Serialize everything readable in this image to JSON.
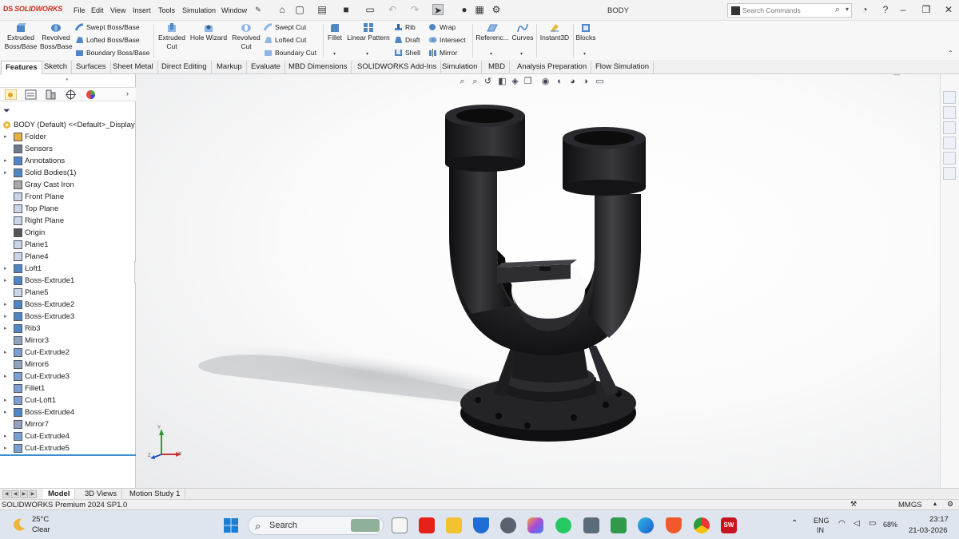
{
  "app": {
    "logo": "SOLIDWORKS",
    "logo_prefix": "DS",
    "document_title": "BODY"
  },
  "menu": [
    "File",
    "Edit",
    "View",
    "Insert",
    "Tools",
    "Simulation",
    "Window"
  ],
  "search": {
    "placeholder": "Search Commands"
  },
  "ribbon": {
    "extruded_boss": "Extruded Boss/Base",
    "revolved_boss": "Revolved Boss/Base",
    "swept_boss": "Swept Boss/Base",
    "lofted_boss": "Lofted Boss/Base",
    "boundary_boss": "Boundary Boss/Base",
    "extruded_cut": "Extruded Cut",
    "hole_wizard": "Hole Wizard",
    "revolved_cut": "Revolved Cut",
    "swept_cut": "Swept Cut",
    "lofted_cut": "Lofted Cut",
    "boundary_cut": "Boundary Cut",
    "fillet": "Fillet",
    "linear_pattern": "Linear Pattern",
    "rib": "Rib",
    "draft": "Draft",
    "shell": "Shell",
    "wrap": "Wrap",
    "intersect": "Intersect",
    "mirror": "Mirror",
    "reference": "Referenc...",
    "curves": "Curves",
    "instant3d": "Instant3D",
    "blocks": "Blocks"
  },
  "tabs": [
    "Features",
    "Sketch",
    "Surfaces",
    "Sheet Metal",
    "Direct Editing",
    "Markup",
    "Evaluate",
    "MBD Dimensions",
    "SOLIDWORKS Add-Ins",
    "Simulation",
    "MBD",
    "Analysis Preparation",
    "Flow Simulation"
  ],
  "tree": {
    "root": "BODY (Default) <<Default>_Display",
    "items": [
      {
        "label": "Folder",
        "expand": true,
        "icon": "folder-icon"
      },
      {
        "label": "Sensors",
        "expand": false,
        "icon": "sensors-icon"
      },
      {
        "label": "Annotations",
        "expand": true,
        "icon": "annotations-icon"
      },
      {
        "label": "Solid Bodies(1)",
        "expand": true,
        "icon": "solid-bodies-icon"
      },
      {
        "label": "Gray Cast Iron",
        "expand": false,
        "icon": "material-icon"
      },
      {
        "label": "Front Plane",
        "expand": false,
        "icon": "plane-icon"
      },
      {
        "label": "Top Plane",
        "expand": false,
        "icon": "plane-icon"
      },
      {
        "label": "Right Plane",
        "expand": false,
        "icon": "plane-icon"
      },
      {
        "label": "Origin",
        "expand": false,
        "icon": "origin-icon"
      },
      {
        "label": "Plane1",
        "expand": false,
        "icon": "plane-icon"
      },
      {
        "label": "Plane4",
        "expand": false,
        "icon": "plane-icon"
      },
      {
        "label": "Loft1",
        "expand": true,
        "icon": "loft-icon"
      },
      {
        "label": "Boss-Extrude1",
        "expand": true,
        "icon": "extrude-icon"
      },
      {
        "label": "Plane5",
        "expand": false,
        "icon": "plane-icon"
      },
      {
        "label": "Boss-Extrude2",
        "expand": true,
        "icon": "extrude-icon"
      },
      {
        "label": "Boss-Extrude3",
        "expand": true,
        "icon": "extrude-icon"
      },
      {
        "label": "Rib3",
        "expand": true,
        "icon": "rib-icon"
      },
      {
        "label": "Mirror3",
        "expand": false,
        "icon": "mirror-icon"
      },
      {
        "label": "Cut-Extrude2",
        "expand": true,
        "icon": "cut-extrude-icon"
      },
      {
        "label": "Mirror6",
        "expand": false,
        "icon": "mirror-icon"
      },
      {
        "label": "Cut-Extrude3",
        "expand": true,
        "icon": "cut-extrude-icon"
      },
      {
        "label": "Fillet1",
        "expand": false,
        "icon": "fillet-icon"
      },
      {
        "label": "Cut-Loft1",
        "expand": true,
        "icon": "cut-loft-icon"
      },
      {
        "label": "Boss-Extrude4",
        "expand": true,
        "icon": "extrude-icon"
      },
      {
        "label": "Mirror7",
        "expand": false,
        "icon": "mirror-icon"
      },
      {
        "label": "Cut-Extrude4",
        "expand": true,
        "icon": "cut-extrude-icon"
      },
      {
        "label": "Cut-Extrude5",
        "expand": true,
        "icon": "cut-extrude-icon"
      }
    ]
  },
  "triad": {
    "x": "X",
    "y": "Y",
    "z": "Z"
  },
  "bottom_tabs": [
    "Model",
    "3D Views",
    "Motion Study 1"
  ],
  "status": {
    "product": "SOLIDWORKS Premium 2024 SP1.0",
    "units": "MMGS"
  },
  "taskbar": {
    "weather_temp": "25°C",
    "weather_desc": "Clear",
    "search_label": "Search",
    "lang1": "ENG",
    "lang2": "IN",
    "battery": "68%",
    "time": "23:17",
    "date": "21-03-2026",
    "sw_badge": "SW"
  },
  "colors": {
    "brand_red": "#d52b1e",
    "selection_blue": "#3a8fd0",
    "model_dark": "#1c1c1e"
  }
}
